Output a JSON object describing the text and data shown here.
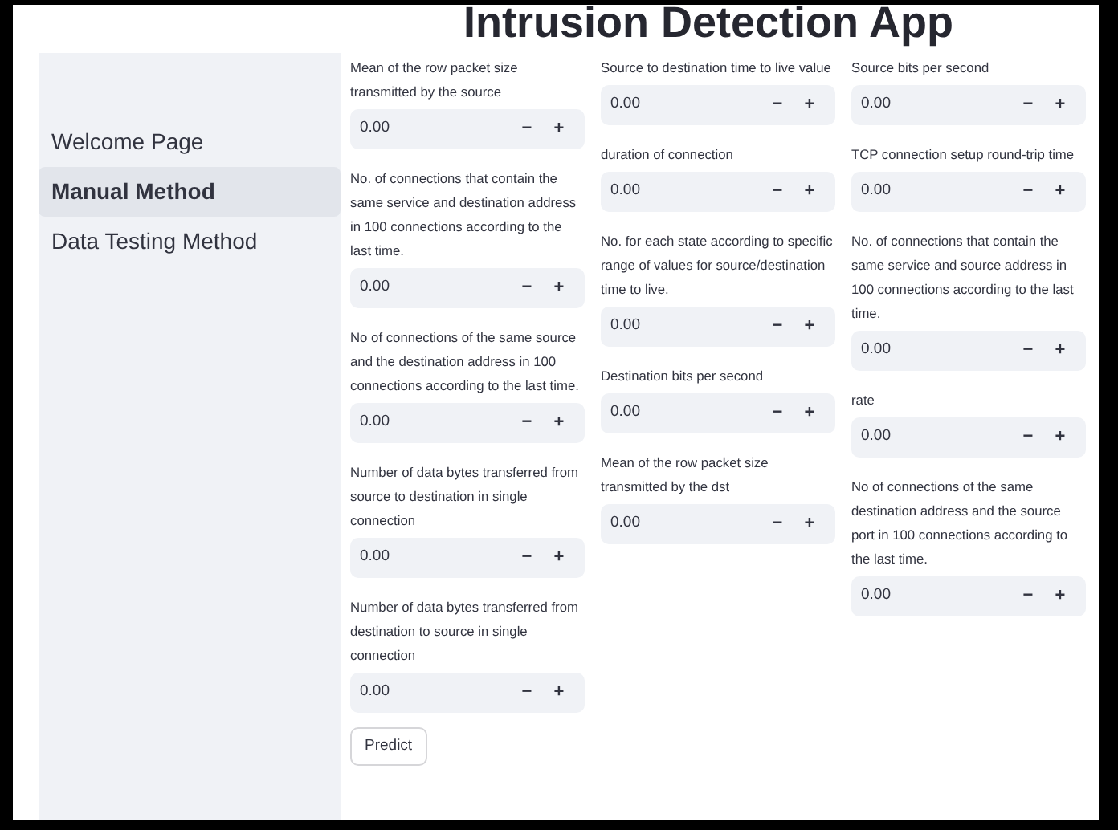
{
  "title": "Intrusion Detection App",
  "sidebar": {
    "items": [
      {
        "label": "Welcome Page",
        "selected": false
      },
      {
        "label": "Manual Method",
        "selected": true
      },
      {
        "label": "Data Testing Method",
        "selected": false
      }
    ]
  },
  "columns": [
    {
      "fields": [
        {
          "label": "Mean of the row packet size transmitted by the source",
          "value": "0.00",
          "minus": "−",
          "plus": "+"
        },
        {
          "label": "No. of connections that contain the same service and destination address in 100 connections according to the last time.",
          "value": "0.00",
          "minus": "−",
          "plus": "+"
        },
        {
          "label": "No of connections of the same source and the destination address in 100 connections according to the last time.",
          "value": "0.00",
          "minus": "−",
          "plus": "+"
        },
        {
          "label": "Number of data bytes transferred from source to destination in single connection",
          "value": "0.00",
          "minus": "−",
          "plus": "+"
        },
        {
          "label": "Number of data bytes transferred from destination to source in single connection",
          "value": "0.00",
          "minus": "−",
          "plus": "+"
        }
      ]
    },
    {
      "fields": [
        {
          "label": "Source to destination time to live value",
          "value": "0.00",
          "minus": "−",
          "plus": "+"
        },
        {
          "label": "duration of connection",
          "value": "0.00",
          "minus": "−",
          "plus": "+"
        },
        {
          "label": "No. for each state according to specific range of values for source/destination time to live.",
          "value": "0.00",
          "minus": "−",
          "plus": "+"
        },
        {
          "label": "Destination bits per second",
          "value": "0.00",
          "minus": "−",
          "plus": "+"
        },
        {
          "label": "Mean of the row packet size transmitted by the dst",
          "value": "0.00",
          "minus": "−",
          "plus": "+"
        }
      ]
    },
    {
      "fields": [
        {
          "label": "Source bits per second",
          "value": "0.00",
          "minus": "−",
          "plus": "+"
        },
        {
          "label": "TCP connection setup round-trip time",
          "value": "0.00",
          "minus": "−",
          "plus": "+"
        },
        {
          "label": "No. of connections that contain the same service and source address in 100 connections according to the last time.",
          "value": "0.00",
          "minus": "−",
          "plus": "+"
        },
        {
          "label": "rate",
          "value": "0.00",
          "minus": "−",
          "plus": "+"
        },
        {
          "label": "No of connections of the same destination address and the source port in 100 connections according to the last time.",
          "value": "0.00",
          "minus": "−",
          "plus": "+"
        }
      ]
    }
  ],
  "predict_button": "Predict"
}
